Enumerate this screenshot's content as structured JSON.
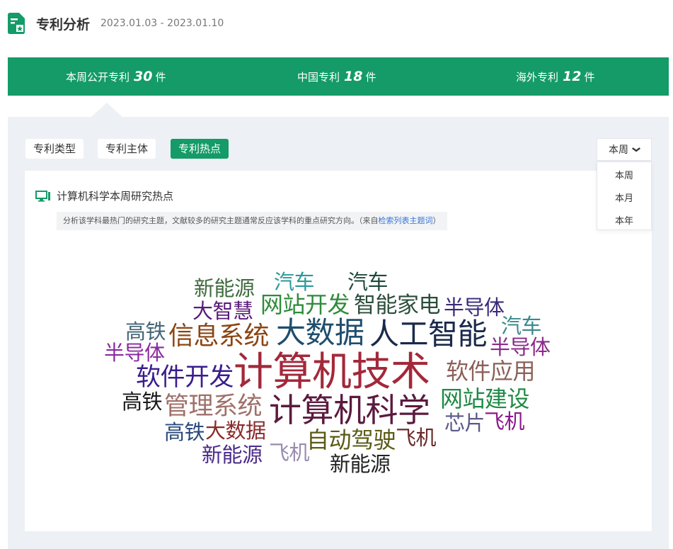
{
  "header": {
    "title": "专利分析",
    "date_range": "2023.01.03 - 2023.01.10"
  },
  "stats": [
    {
      "label": "本周公开专利",
      "value": "30",
      "unit": "件"
    },
    {
      "label": "中国专利",
      "value": "18",
      "unit": "件"
    },
    {
      "label": "海外专利",
      "value": "12",
      "unit": "件"
    }
  ],
  "tabs": [
    {
      "label": "专利类型"
    },
    {
      "label": "专利主体"
    },
    {
      "label": "专利热点"
    }
  ],
  "active_tab": "专利热点",
  "period_select": {
    "value": "本周",
    "options": [
      "本周",
      "本月",
      "本年"
    ]
  },
  "card": {
    "title": "计算机科学本周研究热点",
    "hint_text": "分析该学科最热门的研究主题，文献较多的研究主题通常反应该学科的重点研究方向。（来自",
    "hint_link": "检索列表主题词",
    "hint_end": "）"
  },
  "colors": {
    "brand": "#149b67",
    "panel": "#edf0f5"
  },
  "icons": [
    "document-icon",
    "monitor-icon",
    "chevron-down-icon"
  ],
  "word_cloud": [
    {
      "text": "计算机技术",
      "color": "#a3283a"
    },
    {
      "text": "计算机科学",
      "color": "#5b1a3e"
    },
    {
      "text": "大数据",
      "color": "#1f4e6e"
    },
    {
      "text": "人工智能",
      "color": "#1a2a4a"
    },
    {
      "text": "信息系统",
      "color": "#8b4513"
    },
    {
      "text": "软件开发",
      "color": "#3a1d8c"
    },
    {
      "text": "管理系统",
      "color": "#a0706a"
    },
    {
      "text": "网站开发",
      "color": "#2e8b3a"
    },
    {
      "text": "智能家电",
      "color": "#2b4d3a"
    },
    {
      "text": "软件应用",
      "color": "#8b6058"
    },
    {
      "text": "网站建设",
      "color": "#1e8a45"
    },
    {
      "text": "自动驾驶",
      "color": "#5a5a16"
    },
    {
      "text": "新能源",
      "color": "#3f6b3f"
    },
    {
      "text": "汽车",
      "color": "#2a9a9a"
    },
    {
      "text": "汽车",
      "color": "#1e4a3a"
    },
    {
      "text": "大智慧",
      "color": "#5a1a7a"
    },
    {
      "text": "半导体",
      "color": "#3a2a7a"
    },
    {
      "text": "汽车",
      "color": "#3a8a8a"
    },
    {
      "text": "高铁",
      "color": "#446677"
    },
    {
      "text": "半导体",
      "color": "#8a2aa0"
    },
    {
      "text": "半导体",
      "color": "#8a2a8a"
    },
    {
      "text": "高铁",
      "color": "#1a1a1a"
    },
    {
      "text": "芯片",
      "color": "#5a5a88"
    },
    {
      "text": "飞机",
      "color": "#8a1a8a"
    },
    {
      "text": "高铁",
      "color": "#2a4a7a"
    },
    {
      "text": "大数据",
      "color": "#8a2a2a"
    },
    {
      "text": "飞机",
      "color": "#6a2a2a"
    },
    {
      "text": "新能源",
      "color": "#4a2a8a"
    },
    {
      "text": "飞机",
      "color": "#9a8ab0"
    },
    {
      "text": "新能源",
      "color": "#222222"
    }
  ]
}
